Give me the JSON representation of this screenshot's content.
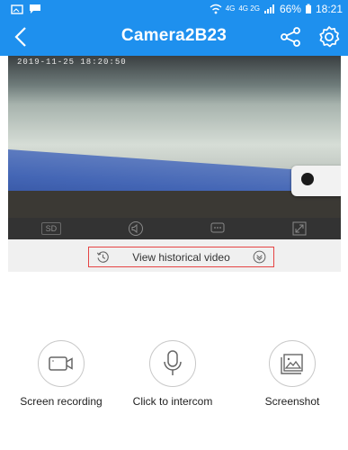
{
  "statusbar": {
    "network": "4G",
    "network_small": "4G 2G",
    "battery": "66%",
    "time": "18:21"
  },
  "header": {
    "title": "Camera2B23"
  },
  "video": {
    "timestamp": "2019-11-25 18:20:50"
  },
  "controls": {
    "quality_label": "SD"
  },
  "history": {
    "label": "View historical video"
  },
  "actions": [
    {
      "label": "Screen recording",
      "icon": "video-camera-icon"
    },
    {
      "label": "Click to intercom",
      "icon": "microphone-icon"
    },
    {
      "label": "Screenshot",
      "icon": "image-icon"
    }
  ],
  "colors": {
    "accent": "#1e90ee",
    "highlight_border": "#e64444"
  }
}
